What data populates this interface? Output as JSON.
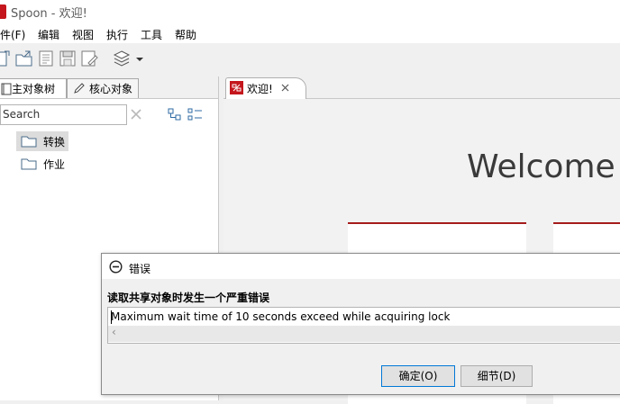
{
  "window": {
    "title": "Spoon - 欢迎!"
  },
  "menu": [
    {
      "label": "件(F)"
    },
    {
      "label": "编辑"
    },
    {
      "label": "视图"
    },
    {
      "label": "执行"
    },
    {
      "label": "工具"
    },
    {
      "label": "帮助"
    }
  ],
  "left_panel": {
    "tabs": [
      {
        "label": "主对象树"
      },
      {
        "label": "核心对象"
      }
    ],
    "search": {
      "placeholder": "Search",
      "value": ""
    },
    "tree": [
      {
        "label": "转换"
      },
      {
        "label": "作业"
      }
    ]
  },
  "right_panel": {
    "tab": {
      "label": "欢迎!"
    },
    "heading": "Welcome t"
  },
  "dialog": {
    "title": "错误",
    "message": "读取共享对象时发生一个严重错误",
    "detail": "Maximum wait time of 10 seconds exceed while acquiring lock",
    "scroll_left_glyph": "‹",
    "ok_label": "确定(O)",
    "details_label": "细节(D)"
  },
  "colors": {
    "accent_red": "#c4161c",
    "card_rule": "#a51c1c",
    "ok_focus": "#0078d7"
  }
}
